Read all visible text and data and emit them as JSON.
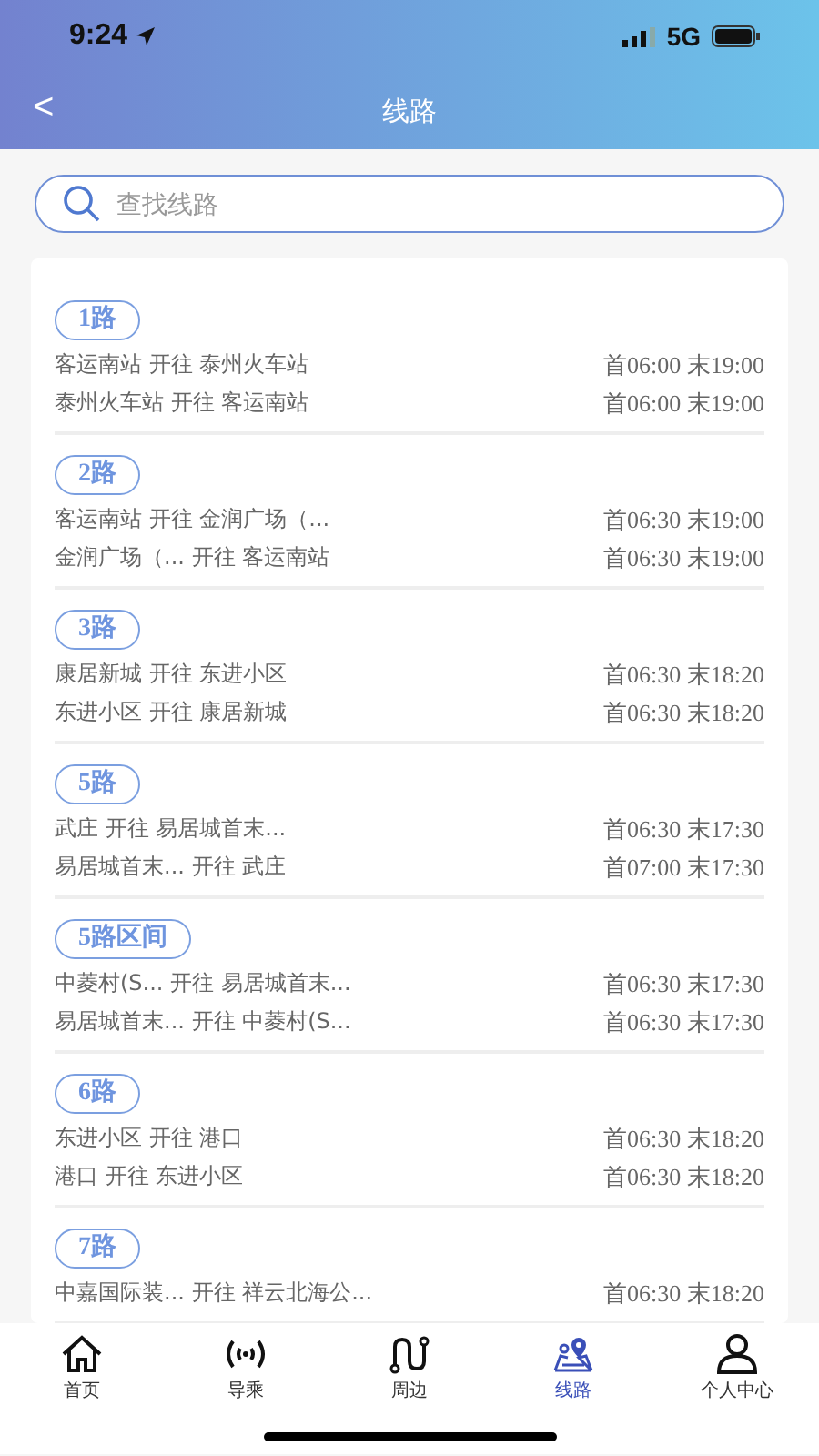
{
  "status_bar": {
    "time": "9:24",
    "network": "5G"
  },
  "nav": {
    "back": "<",
    "title": "线路"
  },
  "search": {
    "placeholder": "查找线路"
  },
  "routes": [
    {
      "name": "1路",
      "directions": [
        {
          "text": "客运南站 开往 泰州火车站",
          "times": "首06:00 末19:00"
        },
        {
          "text": "泰州火车站 开往 客运南站",
          "times": "首06:00 末19:00"
        }
      ]
    },
    {
      "name": "2路",
      "directions": [
        {
          "text": "客运南站 开往 金润广场（...",
          "times": "首06:30 末19:00"
        },
        {
          "text": "金润广场（... 开往 客运南站",
          "times": "首06:30 末19:00"
        }
      ]
    },
    {
      "name": "3路",
      "directions": [
        {
          "text": "康居新城 开往 东进小区",
          "times": "首06:30 末18:20"
        },
        {
          "text": "东进小区 开往 康居新城",
          "times": "首06:30 末18:20"
        }
      ]
    },
    {
      "name": "5路",
      "directions": [
        {
          "text": "武庄 开往 易居城首末...",
          "times": "首06:30 末17:30"
        },
        {
          "text": "易居城首末... 开往 武庄",
          "times": "首07:00 末17:30"
        }
      ]
    },
    {
      "name": "5路区间",
      "directions": [
        {
          "text": "中菱村(S... 开往 易居城首末...",
          "times": "首06:30 末17:30"
        },
        {
          "text": "易居城首末... 开往 中菱村(S...",
          "times": "首06:30 末17:30"
        }
      ]
    },
    {
      "name": "6路",
      "directions": [
        {
          "text": "东进小区 开往 港口",
          "times": "首06:30 末18:20"
        },
        {
          "text": "港口 开往 东进小区",
          "times": "首06:30 末18:20"
        }
      ]
    },
    {
      "name": "7路",
      "directions": [
        {
          "text": "中嘉国际装... 开往 祥云北海公...",
          "times": "首06:30 末18:20"
        }
      ]
    }
  ],
  "tab_bar": [
    {
      "kind": "home",
      "label": "首页",
      "selected": false
    },
    {
      "kind": "signal",
      "label": "导乘",
      "selected": false
    },
    {
      "kind": "route",
      "label": "周边",
      "selected": false
    },
    {
      "kind": "map",
      "label": "线路",
      "selected": true
    },
    {
      "kind": "person",
      "label": "个人中心",
      "selected": false
    }
  ]
}
